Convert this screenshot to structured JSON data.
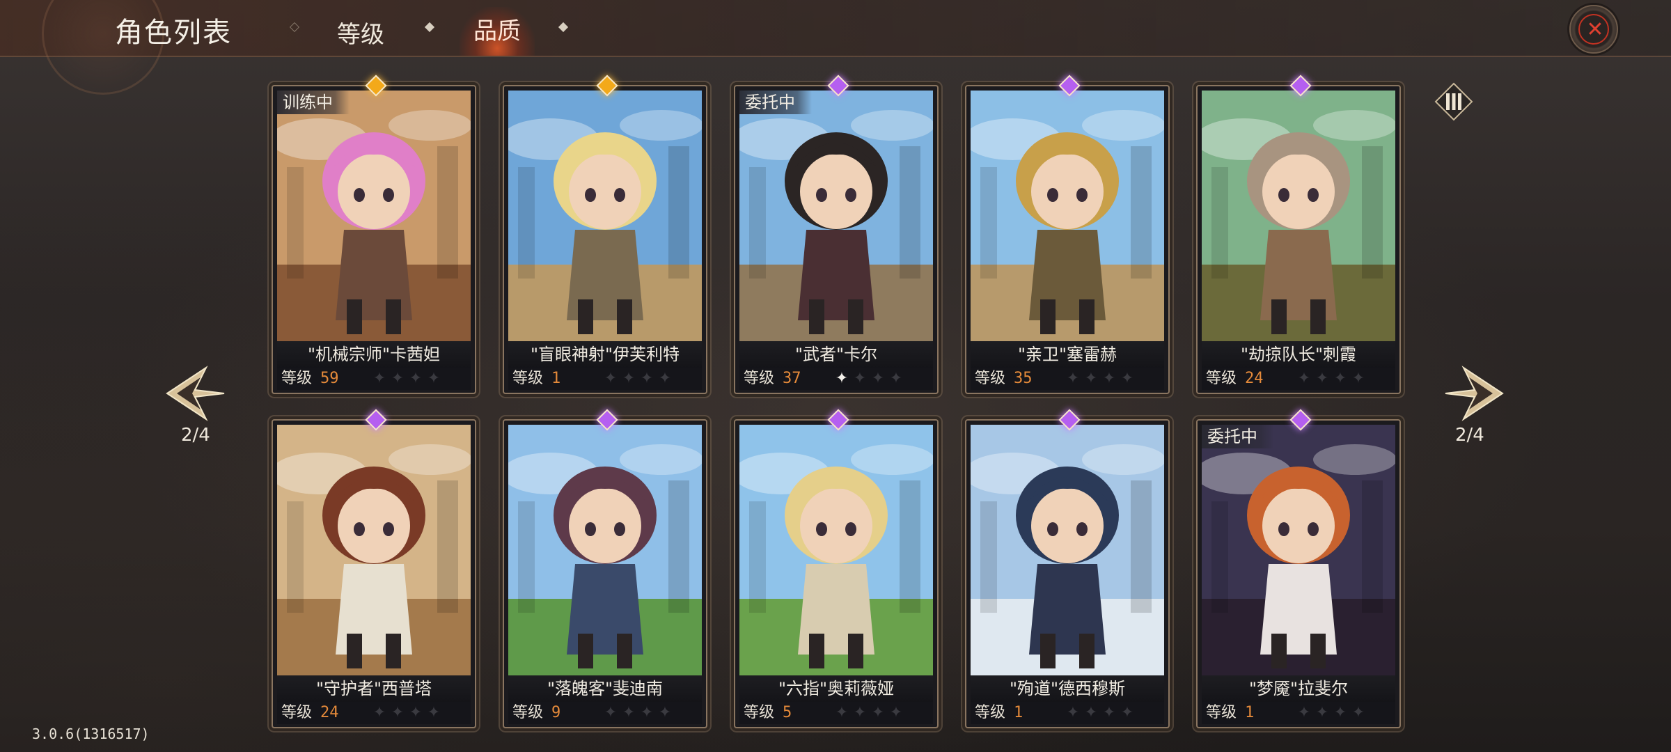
{
  "header": {
    "title": "角色列表",
    "tabs": [
      {
        "label": "等级"
      },
      {
        "label": "品质",
        "active": true
      }
    ]
  },
  "pager": {
    "left": "2/4",
    "right": "2/4"
  },
  "version": "3.0.6(1316517)",
  "level_label": "等级",
  "cards": [
    {
      "name": "\"机械宗师\"卡茜妲",
      "level": "59",
      "status": "训练中",
      "gem": "gold",
      "stars_lit": 0,
      "art": {
        "sky": "#c99a6a",
        "ground": "#8a5a38",
        "hair": "#e07fc8",
        "outfit": "#6b4a3a"
      }
    },
    {
      "name": "\"盲眼神射\"伊芙利特",
      "level": "1",
      "status": "",
      "gem": "gold",
      "stars_lit": 0,
      "art": {
        "sky": "#6fa6d8",
        "ground": "#b89a6a",
        "hair": "#e9d58a",
        "outfit": "#7a6a50"
      }
    },
    {
      "name": "\"武者\"卡尔",
      "level": "37",
      "status": "委托中",
      "gem": "purple",
      "stars_lit": 1,
      "art": {
        "sky": "#7fb3df",
        "ground": "#8f7b5e",
        "hair": "#2b2524",
        "outfit": "#4a2f33"
      }
    },
    {
      "name": "\"亲卫\"塞雷赫",
      "level": "35",
      "status": "",
      "gem": "purple",
      "stars_lit": 0,
      "art": {
        "sky": "#8cbfe6",
        "ground": "#b79a6c",
        "hair": "#c8a04a",
        "outfit": "#6b5a3a"
      }
    },
    {
      "name": "\"劫掠队长\"刺霞",
      "level": "24",
      "status": "",
      "gem": "purple",
      "stars_lit": 0,
      "art": {
        "sky": "#7fb28a",
        "ground": "#6b6a3a",
        "hair": "#a89480",
        "outfit": "#8a6a4e"
      }
    },
    {
      "name": "\"守护者\"西普塔",
      "level": "24",
      "status": "",
      "gem": "purple",
      "stars_lit": 0,
      "art": {
        "sky": "#d4b488",
        "ground": "#a47a4c",
        "hair": "#7a3a26",
        "outfit": "#e7e0d0"
      }
    },
    {
      "name": "\"落魄客\"斐迪南",
      "level": "9",
      "status": "",
      "gem": "purple",
      "stars_lit": 0,
      "art": {
        "sky": "#8fbfe8",
        "ground": "#5f9a4a",
        "hair": "#5e3a4a",
        "outfit": "#3a4a6a"
      }
    },
    {
      "name": "\"六指\"奥莉薇娅",
      "level": "5",
      "status": "",
      "gem": "purple",
      "stars_lit": 0,
      "art": {
        "sky": "#8fc3ea",
        "ground": "#6aa24c",
        "hair": "#e5cf8a",
        "outfit": "#d8ccb0"
      }
    },
    {
      "name": "\"殉道\"德西穆斯",
      "level": "1",
      "status": "",
      "gem": "purple",
      "stars_lit": 0,
      "art": {
        "sky": "#a7c7e6",
        "ground": "#dfe8f0",
        "hair": "#2b3a58",
        "outfit": "#2e3650"
      }
    },
    {
      "name": "\"梦魇\"拉斐尔",
      "level": "1",
      "status": "委托中",
      "gem": "purple",
      "stars_lit": 0,
      "art": {
        "sky": "#3a3450",
        "ground": "#2a2030",
        "hair": "#c8622e",
        "outfit": "#e8e2e0"
      }
    }
  ]
}
